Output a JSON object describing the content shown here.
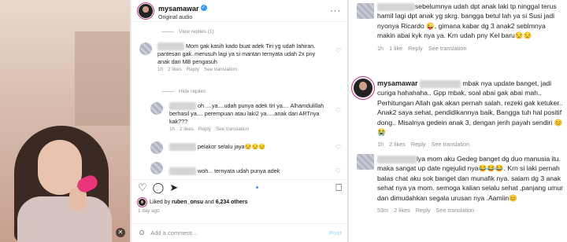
{
  "post": {
    "username": "mysamawar",
    "subtitle": "Original audio",
    "view_replies": "View replies (1)",
    "hide_replies": "Hide replies",
    "liked_prefix": "Liked by",
    "liked_user": "ruben_onsu",
    "liked_mid": "and",
    "liked_count": "6,234 others",
    "time_ago": "1 day ago",
    "add_comment": "Add a comment...",
    "post_button": "Post"
  },
  "left_comments": [
    {
      "text": "Mom gak kasih kado buat adek Tiri yg udah lahiran. pantesan gak..merusuh lagi ya si mantan ternyata udah 2x pny anak dari MB pengasuh",
      "time": "1h",
      "likes": "2 likes",
      "reply": "Reply",
      "translate": "See translation"
    },
    {
      "text": "oh ....ya....udah punya adek tiri ya.... Alhamdulillah berhasil ya.... perempuan atau laki2 ya.....anak dari ARTnya kak???",
      "time": "1h",
      "likes": "2 likes",
      "reply": "Reply",
      "translate": "See translation"
    },
    {
      "text": "pelakor selalu jaya😒😒😒"
    },
    {
      "text": "woh... ternyata udah punya adek"
    }
  ],
  "right_comments": [
    {
      "text": "sebelumnya udah dpt anak laki tp ninggal terus hamil lagi dpt anak yg skrg. bangga betul lah ya si Susi jadi nyonya Ricardo 😜, gimana kabar dg 3 anak2 seblmnya makin abai kyk nya ya. Krn udah pny Kel baru😒😒",
      "time": "1h",
      "likes": "1 like",
      "reply": "Reply",
      "translate": "See translation"
    },
    {
      "username": "mysamawar",
      "text": "mbak nya update banget, jadi curiga hahahaha.. Gpp mbak, soal abai gak abai mah.. Perhitungan Allah gak akan pernah salah, rezeki gak ketuker.. Anak2 saya sehat, pendidikannya baik, Bangga tuh hal positif dong.. Misalnya gedein anak 3, dengan jerih payah sendiri 😊😭",
      "time": "1h",
      "likes": "2 likes",
      "reply": "Reply",
      "translate": "See translation"
    },
    {
      "text": "lya mom aku Gedeg banget dg duo manusia itu. maka sangat up date ngejulid nya😂😂😂. Krn si laki pernah balas chat aku sok banget dan munafik nya. salam dg 3 anak sehat nya ya mom. semoga kalian selalu sehat ,panjang umur dan dimudahkan segala urusan nya .Aamiin😊",
      "time": "53m",
      "likes": "2 likes",
      "reply": "Reply",
      "translate": "See translation"
    }
  ],
  "icons": [
    "heart-icon",
    "comment-icon",
    "share-icon",
    "bookmark-icon",
    "more-icon",
    "verified-icon",
    "mute-icon"
  ]
}
